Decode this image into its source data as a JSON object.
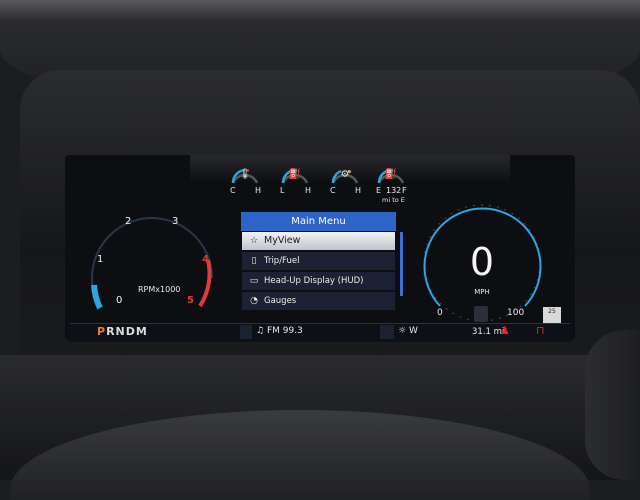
{
  "top_gauges": [
    {
      "name": "coolant-temp",
      "low": "C",
      "high": "H",
      "level": 0.5
    },
    {
      "name": "oil-temp",
      "low": "L",
      "high": "H",
      "level": 0.55
    },
    {
      "name": "trans-temp",
      "low": "C",
      "high": "H",
      "level": 0.4
    },
    {
      "name": "fuel",
      "low": "E",
      "high": "F",
      "level": 0.55,
      "range_value": "132",
      "range_unit": "mi to E"
    }
  ],
  "tach": {
    "ticks": [
      "0",
      "1",
      "2",
      "3",
      "4",
      "5"
    ],
    "redline_start": "4",
    "unit": "RPMx1000",
    "level": 0.08,
    "accent": "#2aa6e0",
    "redline_color": "#e23a3a"
  },
  "menu": {
    "title": "Main Menu",
    "items": [
      {
        "label": "MyView",
        "icon": "star-icon",
        "selected": true
      },
      {
        "label": "Trip/Fuel",
        "icon": "trip-icon",
        "selected": false
      },
      {
        "label": "Head-Up Display (HUD)",
        "icon": "hud-icon",
        "selected": false
      },
      {
        "label": "Gauges",
        "icon": "gauge-icon",
        "selected": false
      }
    ],
    "accent": "#2d64c8"
  },
  "speedo": {
    "value": "0",
    "unit": "MPH",
    "min_label": "0",
    "max_label": "100",
    "accent": "#2aa6e0"
  },
  "status": {
    "gear_active": "P",
    "gear_rest": "RNDM",
    "radio": "FM 99.3",
    "compass": "W",
    "odometer": "31.1 mi",
    "speed_limit_badge": "25"
  }
}
